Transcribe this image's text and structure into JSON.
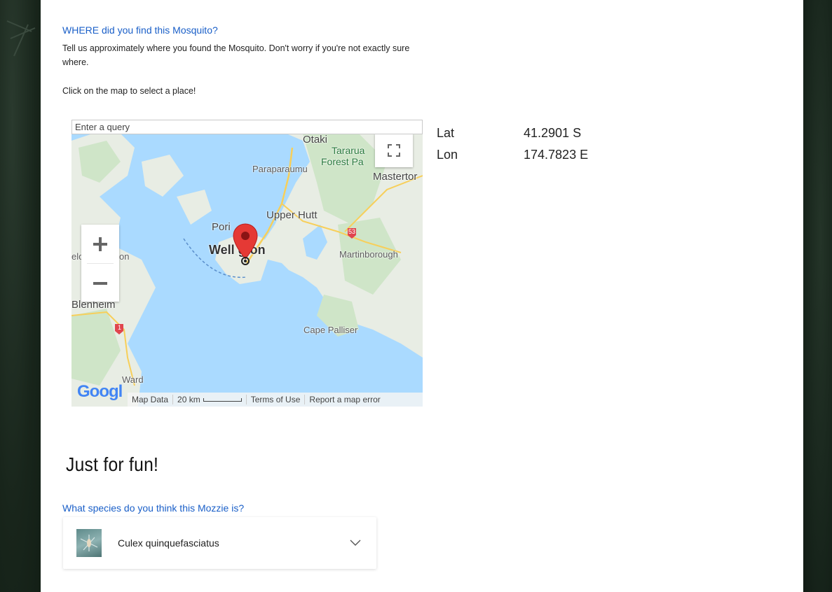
{
  "location": {
    "title": "WHERE did you find this Mosquito?",
    "description": "Tell us approximately where you found the Mosquito. Don't worry if you're not exactly sure where.",
    "hint": "Click on the map to select a place!"
  },
  "map": {
    "search_placeholder": "Enter a query",
    "labels": {
      "otaki": "Otaki",
      "tararua": "Tararua",
      "forest_park": "Forest Pa",
      "paraparaumu": "Paraparaumu",
      "masterton": "Mastertor",
      "upper_hutt": "Upper Hutt",
      "porirua": "Pori",
      "wellington": "Well  gton",
      "martinborough": "Martinborough",
      "nelson": "elo",
      "havelock": "on",
      "blenheim": "Blenheim",
      "cape_palliser": "Cape Palliser",
      "ward": "Ward",
      "route_53": "53",
      "route_1": "1"
    },
    "footer": {
      "map_data": "Map Data",
      "scale": "20 km",
      "terms": "Terms of Use",
      "report": "Report a map error"
    },
    "logo": "Googl"
  },
  "coordinates": {
    "lat_label": "Lat",
    "lat_value": "41.2901 S",
    "lon_label": "Lon",
    "lon_value": "174.7823 E"
  },
  "fun": {
    "title": "Just for fun!",
    "species_question": "What species do you think this Mozzie is?",
    "selected_species": "Culex quinquefasciatus"
  },
  "colors": {
    "accent": "#1a5fc8",
    "water": "#aadaff",
    "marker": "#e53935"
  }
}
